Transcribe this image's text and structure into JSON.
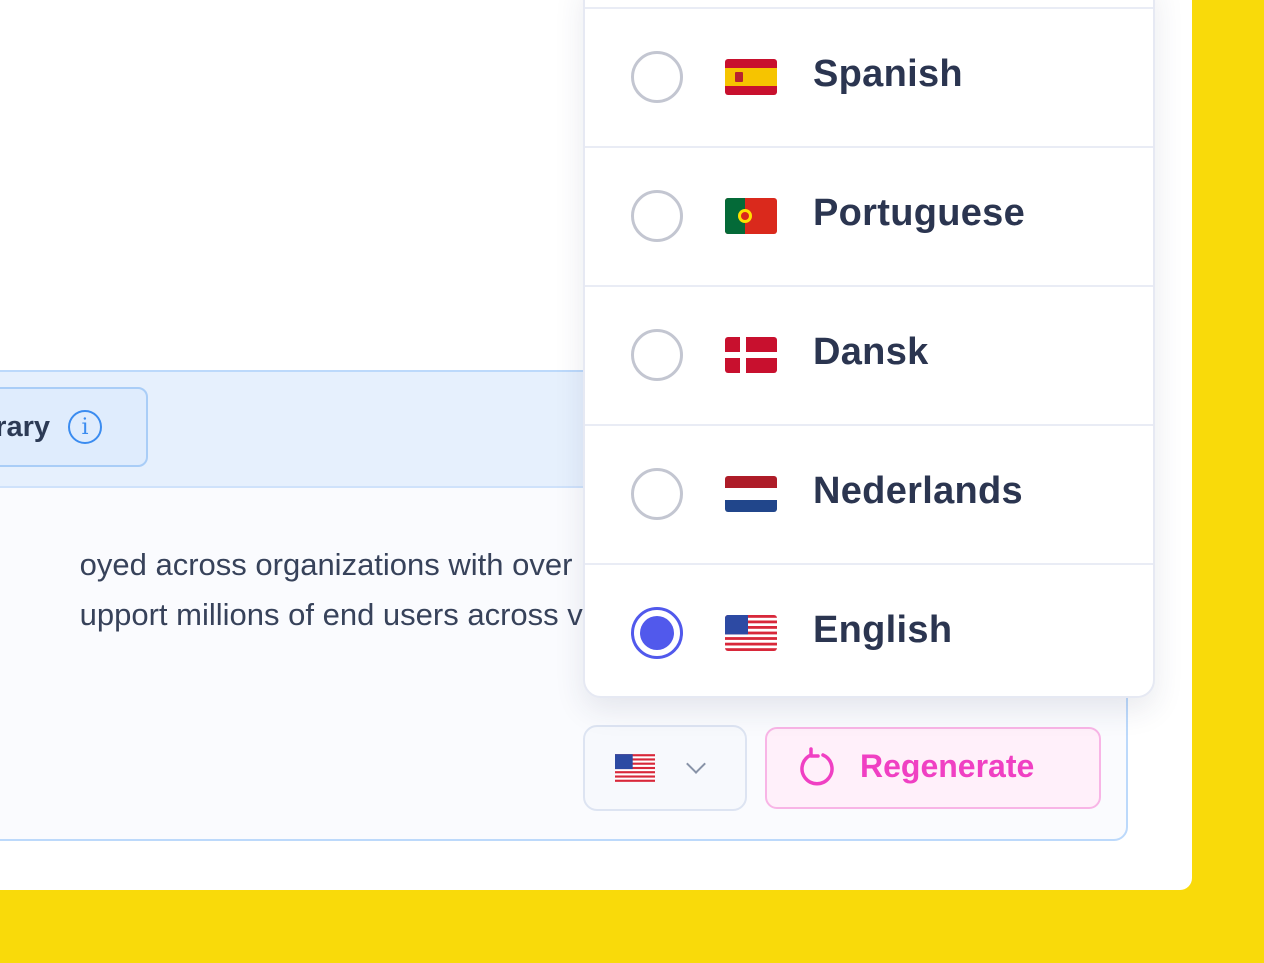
{
  "library_chip": {
    "label": "rary",
    "info_icon": "info-icon"
  },
  "body_text": {
    "line1": "oyed across organizations with over",
    "line2": "upport millions of end users across va"
  },
  "language_button": {
    "selected_flag": "us-flag-icon",
    "chevron": "chevron-down-icon"
  },
  "regenerate_button": {
    "label": "Regenerate",
    "icon": "refresh-icon"
  },
  "language_options": [
    {
      "label": "Spanish",
      "flag": "es-flag-icon",
      "selected": false
    },
    {
      "label": "Portuguese",
      "flag": "pt-flag-icon",
      "selected": false
    },
    {
      "label": "Dansk",
      "flag": "dk-flag-icon",
      "selected": false
    },
    {
      "label": "Nederlands",
      "flag": "nl-flag-icon",
      "selected": false
    },
    {
      "label": "English",
      "flag": "us-flag-icon",
      "selected": true
    }
  ],
  "colors": {
    "background": "#f9da0a",
    "accent_radio": "#5159ec",
    "regenerate": "#f040c3",
    "info": "#3b8cf0"
  }
}
